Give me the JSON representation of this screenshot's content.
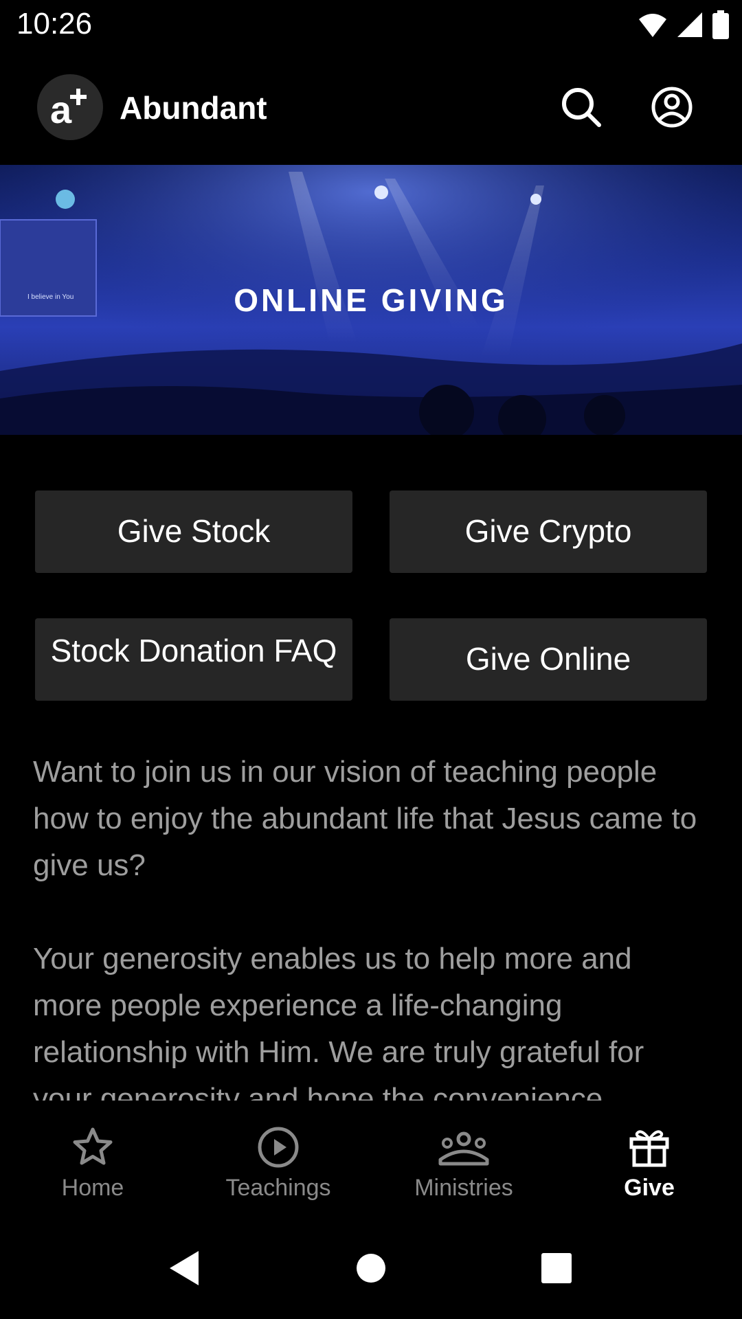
{
  "status_bar": {
    "time": "10:26"
  },
  "app_bar": {
    "title": "Abundant",
    "logo_text": "a+"
  },
  "hero": {
    "title": "ONLINE GIVING",
    "screen_text": "I believe in You\nI believe in You"
  },
  "buttons": {
    "give_stock": "Give Stock",
    "give_crypto": "Give Crypto",
    "stock_faq": "Stock Donation FAQ",
    "give_online": "Give Online"
  },
  "content": {
    "paragraph1": "Want to join us in our vision of teaching people how to enjoy the abundant life that Jesus came to give us?",
    "paragraph2": "Your generosity enables us to help more and more people experience a life-changing relationship with Him. We are truly grateful for your generosity and hope the convenience"
  },
  "bottom_nav": {
    "items": [
      {
        "label": "Home",
        "icon": "star-icon",
        "active": false
      },
      {
        "label": "Teachings",
        "icon": "play-circle-icon",
        "active": false
      },
      {
        "label": "Ministries",
        "icon": "group-icon",
        "active": false
      },
      {
        "label": "Give",
        "icon": "gift-icon",
        "active": true
      }
    ]
  },
  "colors": {
    "background": "#000000",
    "button_bg": "#262626",
    "body_text": "#9e9e9e",
    "nav_inactive": "#8a8a8a"
  }
}
